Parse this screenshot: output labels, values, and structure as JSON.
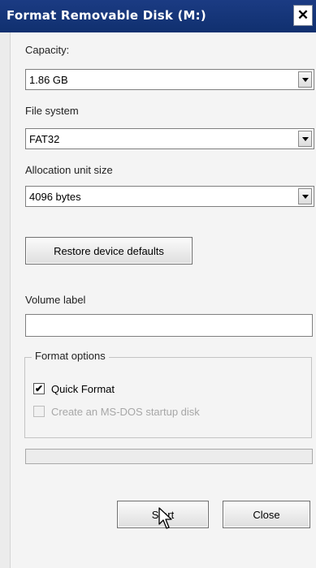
{
  "window": {
    "title": "Format Removable Disk (M:)",
    "close_glyph": "✕"
  },
  "capacity": {
    "label": "Capacity:",
    "value": "1.86 GB"
  },
  "file_system": {
    "label": "File system",
    "value": "FAT32"
  },
  "allocation": {
    "label": "Allocation unit size",
    "value": "4096 bytes"
  },
  "restore_button": {
    "label": "Restore device defaults"
  },
  "volume_label": {
    "label": "Volume label",
    "value": ""
  },
  "format_options": {
    "title": "Format options",
    "quick_format": {
      "label": "Quick Format",
      "checked": true,
      "check_glyph": "✔"
    },
    "msdos_startup": {
      "label": "Create an MS-DOS startup disk",
      "checked": false,
      "enabled": false
    }
  },
  "progress": {
    "fraction": 0
  },
  "buttons": {
    "start": "Start",
    "close": "Close"
  },
  "icons": [
    "close-icon",
    "dropdown-arrow-icon",
    "checkmark-icon",
    "mouse-pointer-icon"
  ]
}
